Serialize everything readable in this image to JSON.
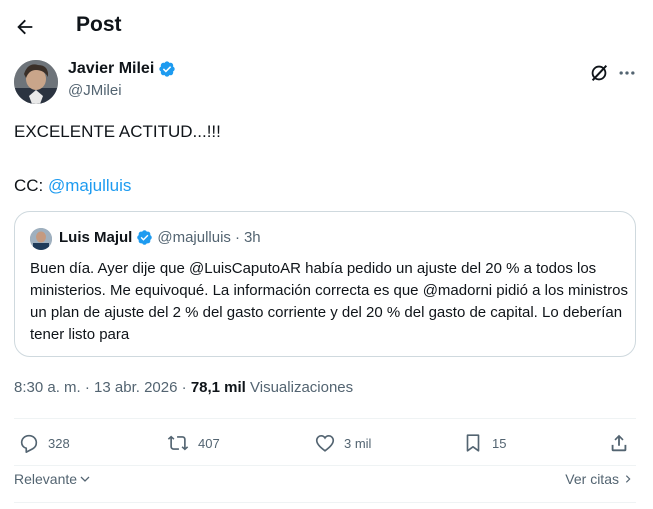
{
  "header": {
    "title": "Post"
  },
  "post": {
    "author_name": "Javier Milei",
    "author_handle": "@JMilei",
    "text_line1": "EXCELENTE ACTITUD...!!!",
    "cc_prefix": "CC: ",
    "cc_mention": "@majulluis"
  },
  "quote": {
    "author_name": "Luis Majul",
    "author_handle": "@majulluis",
    "separator": " · ",
    "time": "3h",
    "text": "Buen día. Ayer dije que @LuisCaputoAR había pedido un ajuste del 20 % a todos los ministerios. Me equivoqué. La información correcta es que @madorni pidió a los ministros un plan de ajuste del 2 % del gasto corriente y del 20 % del gasto de capital. Lo deberían tener listo para"
  },
  "meta": {
    "time": "8:30 a. m.",
    "sep1": " · ",
    "date": "13 abr. 2026",
    "sep2": " · ",
    "views_count": "78,1 mil",
    "views_label": " Visualizaciones"
  },
  "actions": {
    "replies": "328",
    "reposts": "407",
    "likes": "3 mil",
    "bookmarks": "15"
  },
  "footer": {
    "sort_label": "Relevante",
    "quotes_label": "Ver citas"
  },
  "colors": {
    "link": "#1d9bf0",
    "verified": "#1d9bf0",
    "muted": "#536471"
  },
  "icons": [
    "back-arrow-icon",
    "verified-badge-icon",
    "grok-icon",
    "more-icon",
    "reply-icon",
    "repost-icon",
    "like-icon",
    "bookmark-icon",
    "share-icon",
    "chevron-down-icon",
    "chevron-right-icon"
  ]
}
